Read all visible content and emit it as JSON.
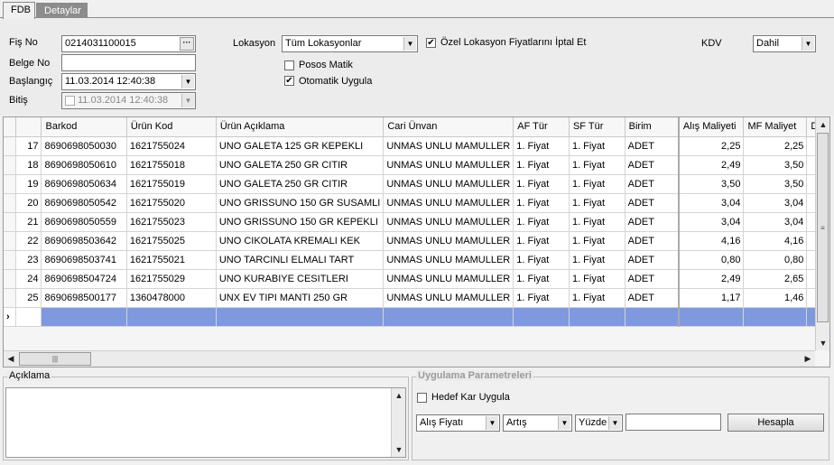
{
  "tabs": [
    {
      "label": "FDB"
    },
    {
      "label": "Detaylar"
    }
  ],
  "header": {
    "fis_no": {
      "label": "Fiş No",
      "value": "0214031100015"
    },
    "belge_no": {
      "label": "Belge No",
      "value": ""
    },
    "baslangic": {
      "label": "Başlangıç",
      "value": "11.03.2014 12:40:38"
    },
    "bitis": {
      "label": "Bitiş",
      "value": "11.03.2014 12:40:38",
      "checked": false
    },
    "lokasyon": {
      "label": "Lokasyon",
      "value": "Tüm Lokasyonlar"
    },
    "ozel_lokasyon": {
      "label": "Özel Lokasyon Fiyatlarını İptal Et",
      "checked": true
    },
    "posos_matik": {
      "label": "Posos Matik",
      "checked": false
    },
    "otomatik_uygula": {
      "label": "Otomatik Uygula",
      "checked": true
    },
    "kdv": {
      "label": "KDV",
      "value": "Dahil"
    }
  },
  "grid": {
    "columns": [
      "Barkod",
      "Ürün Kod",
      "Ürün Açıklama",
      "Cari Ünvan",
      "AF Tür",
      "SF Tür",
      "Birim",
      "Alış Maliyeti",
      "MF Maliyet",
      "D"
    ],
    "rows": [
      {
        "no": "17",
        "barkod": "8690698050030",
        "urun_kod": "1621755024",
        "aciklama": "UNO GALETA 125 GR KEPEKLI",
        "cari": "UNMAS UNLU MAMULLER",
        "af": "1. Fiyat",
        "sf": "1. Fiyat",
        "birim": "ADET",
        "alis": "2,25",
        "mf": "2,25"
      },
      {
        "no": "18",
        "barkod": "8690698050610",
        "urun_kod": "1621755018",
        "aciklama": "UNO GALETA 250 GR CITIR",
        "cari": "UNMAS UNLU MAMULLER",
        "af": "1. Fiyat",
        "sf": "1. Fiyat",
        "birim": "ADET",
        "alis": "2,49",
        "mf": "3,50"
      },
      {
        "no": "19",
        "barkod": "8690698050634",
        "urun_kod": "1621755019",
        "aciklama": "UNO  GALETA 250 GR CITIR",
        "cari": "UNMAS UNLU MAMULLER",
        "af": "1. Fiyat",
        "sf": "1. Fiyat",
        "birim": "ADET",
        "alis": "3,50",
        "mf": "3,50"
      },
      {
        "no": "20",
        "barkod": "8690698050542",
        "urun_kod": "1621755020",
        "aciklama": "UNO GRISSUNO 150 GR SUSAMLI",
        "cari": "UNMAS UNLU MAMULLER",
        "af": "1. Fiyat",
        "sf": "1. Fiyat",
        "birim": "ADET",
        "alis": "3,04",
        "mf": "3,04"
      },
      {
        "no": "21",
        "barkod": "8690698050559",
        "urun_kod": "1621755023",
        "aciklama": "UNO GRISSUNO 150 GR KEPEKLI",
        "cari": "UNMAS UNLU MAMULLER",
        "af": "1. Fiyat",
        "sf": "1. Fiyat",
        "birim": "ADET",
        "alis": "3,04",
        "mf": "3,04"
      },
      {
        "no": "22",
        "barkod": "8690698503642",
        "urun_kod": "1621755025",
        "aciklama": "UNO CIKOLATA KREMALI KEK",
        "cari": "UNMAS UNLU MAMULLER",
        "af": "1. Fiyat",
        "sf": "1. Fiyat",
        "birim": "ADET",
        "alis": "4,16",
        "mf": "4,16"
      },
      {
        "no": "23",
        "barkod": "8690698503741",
        "urun_kod": "1621755021",
        "aciklama": "UNO TARCINLI ELMALI TART",
        "cari": "UNMAS UNLU MAMULLER",
        "af": "1. Fiyat",
        "sf": "1. Fiyat",
        "birim": "ADET",
        "alis": "0,80",
        "mf": "0,80"
      },
      {
        "no": "24",
        "barkod": "8690698504724",
        "urun_kod": "1621755029",
        "aciklama": "UNO KURABIYE CESITLERI",
        "cari": "UNMAS UNLU MAMULLER",
        "af": "1. Fiyat",
        "sf": "1. Fiyat",
        "birim": "ADET",
        "alis": "2,49",
        "mf": "2,65"
      },
      {
        "no": "25",
        "barkod": "8690698500177",
        "urun_kod": "1360478000",
        "aciklama": "UNX EV TIPI MANTI 250 GR",
        "cari": "UNMAS UNLU MAMULLER",
        "af": "1. Fiyat",
        "sf": "1. Fiyat",
        "birim": "ADET",
        "alis": "1,17",
        "mf": "1,46"
      }
    ],
    "new_row_marker": "›"
  },
  "aciklama": {
    "label": "Açıklama",
    "value": ""
  },
  "uygulama": {
    "title": "Uygulama Parametreleri",
    "hedef_kar": {
      "label": "Hedef Kar Uygula",
      "checked": false
    },
    "fiyat_select": "Alış Fiyatı",
    "yon_select": "Artış",
    "tip_select": "Yüzde",
    "deger": "",
    "hesapla_label": "Hesapla"
  },
  "icons": {
    "dropdown": "chevron-down-icon",
    "ellipsis": "ellipsis-icon",
    "check": "checkmark-icon"
  }
}
